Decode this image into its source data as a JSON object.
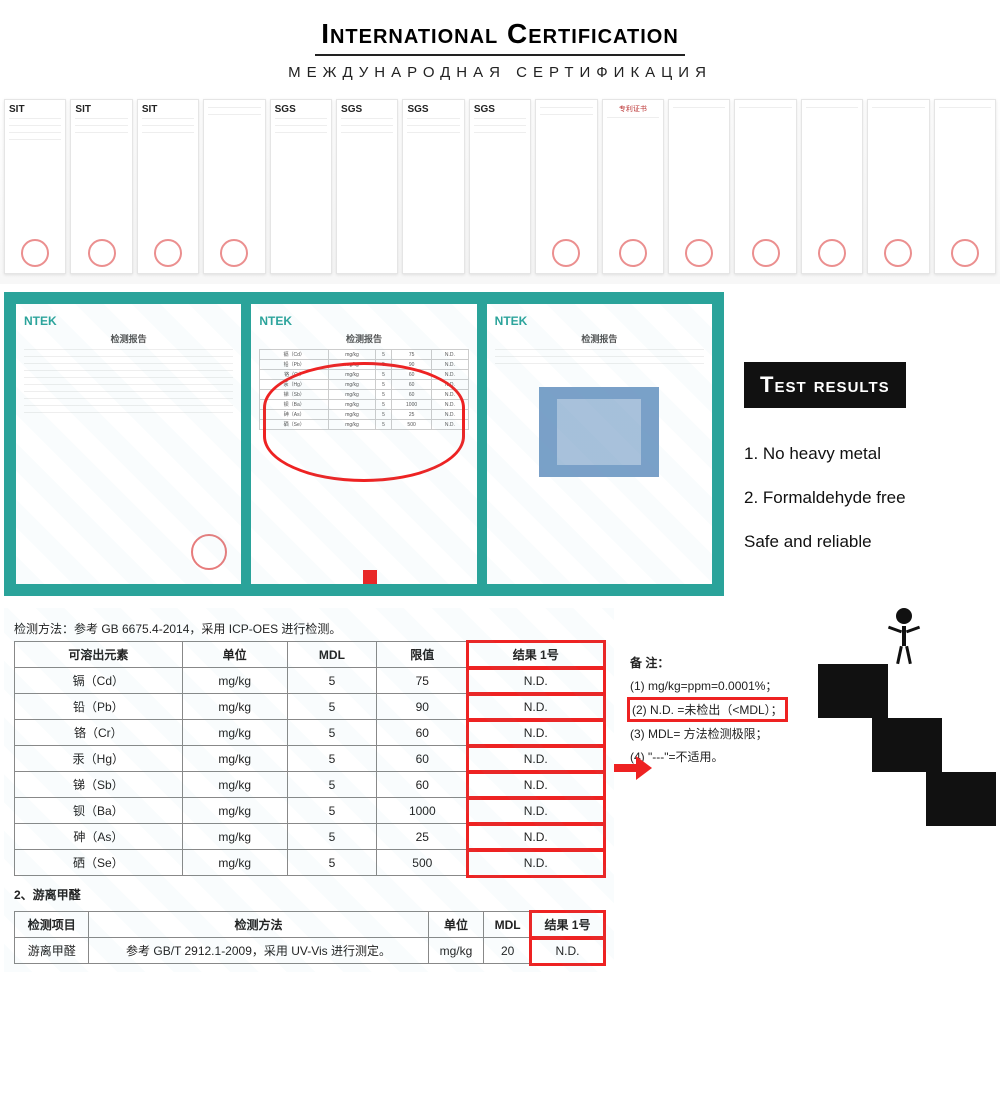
{
  "title": "International Certification",
  "subtitle": "МЕЖДУНАРОДНАЯ СЕРТИФИКАЦИЯ",
  "cert_logos": [
    "SIT",
    "SIT",
    "SIT",
    "",
    "SGS",
    "SGS",
    "SGS",
    "SGS",
    "",
    "专利证书",
    "",
    "",
    "",
    "",
    ""
  ],
  "report_brand": "NTEK",
  "report_title": "检测报告",
  "report_method": "检测方法：参考 GB 6675.4-2014，采用 ICP-OES 进行检测。",
  "table1": {
    "headers": [
      "可溶出元素",
      "单位",
      "MDL",
      "限值",
      "结果 1号"
    ],
    "rows": [
      [
        "镉（Cd）",
        "mg/kg",
        "5",
        "75",
        "N.D."
      ],
      [
        "铅（Pb）",
        "mg/kg",
        "5",
        "90",
        "N.D."
      ],
      [
        "铬（Cr）",
        "mg/kg",
        "5",
        "60",
        "N.D."
      ],
      [
        "汞（Hg）",
        "mg/kg",
        "5",
        "60",
        "N.D."
      ],
      [
        "锑（Sb）",
        "mg/kg",
        "5",
        "60",
        "N.D."
      ],
      [
        "钡（Ba）",
        "mg/kg",
        "5",
        "1000",
        "N.D."
      ],
      [
        "砷（As）",
        "mg/kg",
        "5",
        "25",
        "N.D."
      ],
      [
        "硒（Se）",
        "mg/kg",
        "5",
        "500",
        "N.D."
      ]
    ]
  },
  "section2_title": "2、游离甲醛",
  "table2": {
    "headers": [
      "检测项目",
      "检测方法",
      "单位",
      "MDL",
      "结果 1号"
    ],
    "rows": [
      [
        "游离甲醛",
        "参考 GB/T 2912.1-2009，采用 UV-Vis 进行测定。",
        "mg/kg",
        "20",
        "N.D."
      ]
    ]
  },
  "notes": {
    "title": "备 注：",
    "items": [
      "(1) mg/kg=ppm=0.0001%；",
      "(2) N.D. =未检出（<MDL）；",
      "(3) MDL= 方法检测极限；",
      "(4) \"---\"=不适用。"
    ]
  },
  "rside": {
    "heading": "Test results",
    "items": [
      "1. No heavy metal",
      "2. Formaldehyde free"
    ],
    "safe": "Safe and reliable"
  }
}
